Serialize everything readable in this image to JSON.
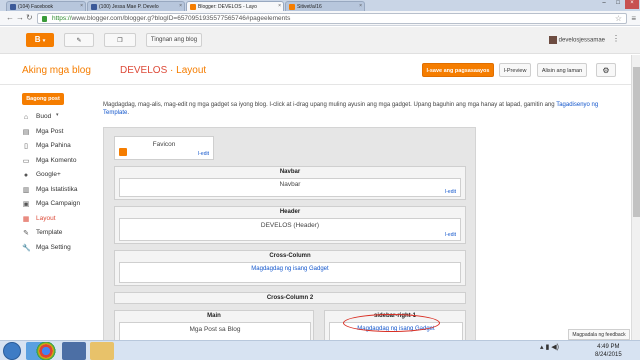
{
  "browser": {
    "tabs": [
      {
        "label": "(104) Facebook",
        "favcolor": "#3b5998"
      },
      {
        "label": "(100) Jessa Mae P. Develo",
        "favcolor": "#3b5998"
      },
      {
        "label": "Blogger: DEVELOS - Layo",
        "favcolor": "#f57d00"
      },
      {
        "label": "Sitivet/a/16",
        "favcolor": "#f57d00"
      }
    ],
    "url_scheme": "https://",
    "url_rest": "www.blogger.com/blogger.g?blogID=6570951935577565746#pageelements"
  },
  "topbar": {
    "view_blog": "Tingnan ang blog",
    "username": "develosjessamae"
  },
  "header": {
    "brand": "Aking mga blog",
    "blog_name": "DEVELOS",
    "separator": "·",
    "section": "Layout",
    "save_button": "I-save ang pagsasaayos",
    "preview_button": "I-Preview",
    "clear_button": "Alisin ang laman"
  },
  "sidebar": {
    "new_post": "Bagong post",
    "items": [
      {
        "label": "Buod",
        "icon": "home-icon"
      },
      {
        "label": "Mga Post",
        "icon": "posts-icon"
      },
      {
        "label": "Mga Pahina",
        "icon": "pages-icon"
      },
      {
        "label": "Mga Komento",
        "icon": "comments-icon"
      },
      {
        "label": "Google+",
        "icon": "gplus-icon"
      },
      {
        "label": "Mga Istatistika",
        "icon": "stats-icon"
      },
      {
        "label": "Mga Campaign",
        "icon": "campaign-icon"
      },
      {
        "label": "Layout",
        "icon": "layout-icon"
      },
      {
        "label": "Template",
        "icon": "template-icon"
      },
      {
        "label": "Mga Setting",
        "icon": "settings-icon"
      }
    ]
  },
  "main": {
    "description": "Magdagdag, mag-alis, mag-edit ng mga gadget sa iyong blog. I-click at i-drag upang muling ayusin ang mga gadget. Upang baguhin ang mga hanay at lapad, gamitin ang",
    "description_link": "Tagadisenyo ng Template",
    "description_end": ".",
    "favicon": {
      "title": "Favicon",
      "edit": "I-edit"
    },
    "navbar": {
      "title": "Navbar",
      "widget": "Navbar",
      "edit": "I-edit"
    },
    "header": {
      "title": "Header",
      "widget": "DEVELOS (Header)",
      "edit": "I-edit"
    },
    "cross1": {
      "title": "Cross-Column",
      "add": "Magdagdag ng isang Gadget"
    },
    "cross2": {
      "title": "Cross-Column 2"
    },
    "main_col": {
      "title": "Main",
      "widget": "Mga Post sa Blog"
    },
    "sidebar_col": {
      "title": "sidebar-right-1",
      "add": "Magdagdag ng isang Gadget"
    }
  },
  "feedback": "Magpadala ng feedback",
  "taskbar": {
    "time": "4:49 PM",
    "date": "8/24/2015"
  }
}
